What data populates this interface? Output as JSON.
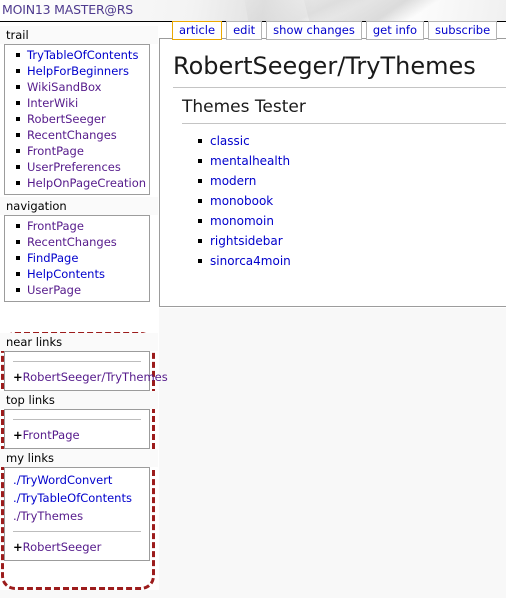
{
  "header": {
    "site_name": "MOIN13 MASTER@RS"
  },
  "tabs": [
    {
      "label": "article",
      "active": true
    },
    {
      "label": "edit",
      "active": false
    },
    {
      "label": "show changes",
      "active": false
    },
    {
      "label": "get info",
      "active": false
    },
    {
      "label": "subscribe",
      "active": false
    }
  ],
  "sidebar": {
    "sections": [
      {
        "title": "trail",
        "items": [
          {
            "label": "TryTableOfContents",
            "visited": false
          },
          {
            "label": "HelpForBeginners",
            "visited": false
          },
          {
            "label": "WikiSandBox",
            "visited": true
          },
          {
            "label": "InterWiki",
            "visited": true
          },
          {
            "label": "RobertSeeger",
            "visited": true
          },
          {
            "label": "RecentChanges",
            "visited": true
          },
          {
            "label": "FrontPage",
            "visited": true
          },
          {
            "label": "UserPreferences",
            "visited": true
          },
          {
            "label": "HelpOnPageCreation",
            "visited": true
          }
        ]
      },
      {
        "title": "navigation",
        "items": [
          {
            "label": "FrontPage",
            "visited": true
          },
          {
            "label": "RecentChanges",
            "visited": true
          },
          {
            "label": "FindPage",
            "visited": false
          },
          {
            "label": "HelpContents",
            "visited": false
          },
          {
            "label": "UserPage",
            "visited": true
          }
        ]
      }
    ],
    "lower_sections": [
      {
        "title": "near links",
        "rule_before": true,
        "rows": [
          {
            "prefix": "+",
            "label": "RobertSeeger/TryThemes",
            "visited": true
          }
        ]
      },
      {
        "title": "top links",
        "rule_before": true,
        "rows": [
          {
            "prefix": "+",
            "label": "FrontPage",
            "visited": true
          }
        ]
      },
      {
        "title": "my links",
        "rule_before": false,
        "rows": [
          {
            "prefix": "",
            "label": "./TryWordConvert",
            "visited": false
          },
          {
            "prefix": "",
            "label": "./TryTableOfContents",
            "visited": false
          },
          {
            "prefix": "",
            "label": "./TryThemes",
            "visited": true
          },
          {
            "rule": true
          },
          {
            "prefix": "+",
            "label": "RobertSeeger",
            "visited": true
          }
        ]
      }
    ]
  },
  "content": {
    "page_title": "RobertSeeger/TryThemes",
    "heading": "Themes Tester",
    "themes": [
      "classic",
      "mentalhealth",
      "modern",
      "monobook",
      "monomoin",
      "rightsidebar",
      "sinorca4moin"
    ]
  },
  "colors": {
    "link": "#0000cc",
    "visited_link": "#551a8b",
    "active_tab_border": "#eba800",
    "highlight_border": "#9c1c1c",
    "site_name": "#4e3a8e"
  }
}
